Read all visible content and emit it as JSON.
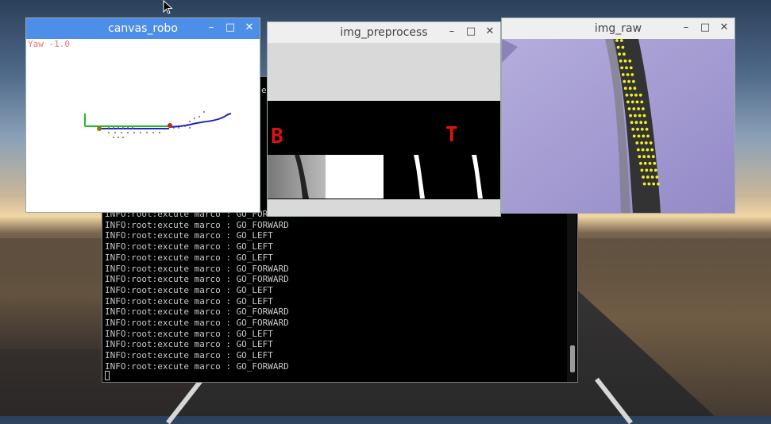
{
  "windows": {
    "robo": {
      "title": "canvas_robo",
      "yaw_label": "Yaw -1.0"
    },
    "preprocess": {
      "title": "img_preprocess",
      "label_left": "B",
      "label_right": "T"
    },
    "raw": {
      "title": "img_raw"
    }
  },
  "controls": {
    "minimize": "–",
    "maximize": "□",
    "close": "✕"
  },
  "terminal": {
    "peek_text": "e",
    "lines": [
      "INFO:root:excute marco : GO_FORWARD",
      "INFO:root:excute marco : GO_FORWARD",
      "INFO:root:excute marco : GO_LEFT",
      "INFO:root:excute marco : GO_LEFT",
      "INFO:root:excute marco : GO_LEFT",
      "INFO:root:excute marco : GO_FORWARD",
      "INFO:root:excute marco : GO_FORWARD",
      "INFO:root:excute marco : GO_LEFT",
      "INFO:root:excute marco : GO_LEFT",
      "INFO:root:excute marco : GO_FORWARD",
      "INFO:root:excute marco : GO_FORWARD",
      "INFO:root:excute marco : GO_LEFT",
      "INFO:root:excute marco : GO_LEFT",
      "INFO:root:excute marco : GO_LEFT",
      "INFO:root:excute marco : GO_FORWARD"
    ]
  },
  "colors": {
    "accent": "#4d8fe8",
    "yaw": "#f17070",
    "path": "#2222cc",
    "axis_green": "#22bb22",
    "dots": "#f0f020"
  }
}
